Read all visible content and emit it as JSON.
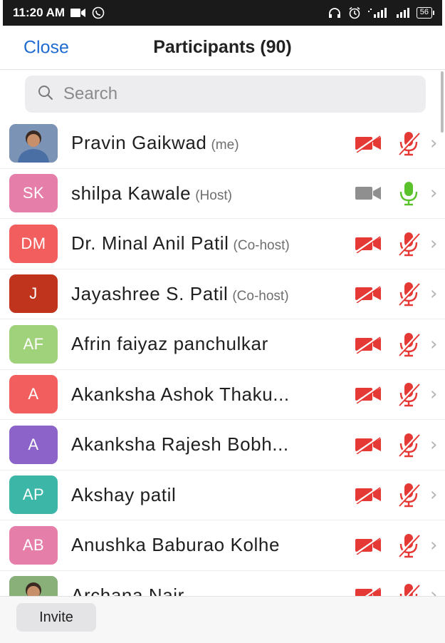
{
  "status_bar": {
    "time": "11:20 AM",
    "battery": "56",
    "left_icons": [
      "video-camera-icon",
      "whatsapp-icon"
    ],
    "right_icons": [
      "headphones-icon",
      "alarm-icon",
      "signal-icon",
      "signal-icon"
    ]
  },
  "header": {
    "close_label": "Close",
    "title": "Participants (90)"
  },
  "search": {
    "placeholder": "Search"
  },
  "colors": {
    "accent": "#1f6bd0",
    "muted_red": "#e53935",
    "unmuted_green": "#5cc22c",
    "video_on_gray": "#8f8f8f"
  },
  "participants": [
    {
      "initials": "",
      "name": "Pravin Gaikwad",
      "role": "(me)",
      "avatar_color": "#7b93b5",
      "video": "off",
      "mic": "muted"
    },
    {
      "initials": "SK",
      "name": "shilpa Kawale",
      "role": "(Host)",
      "avatar_color": "#e57ea9",
      "video": "on",
      "mic": "on"
    },
    {
      "initials": "DM",
      "name": "Dr. Minal Anil Patil",
      "role": "(Co-host)",
      "avatar_color": "#f25d5d",
      "video": "off",
      "mic": "muted"
    },
    {
      "initials": "J",
      "name": "Jayashree S. Patil",
      "role": "(Co-host)",
      "avatar_color": "#c0331c",
      "video": "off",
      "mic": "muted"
    },
    {
      "initials": "AF",
      "name": "Afrin faiyaz panchulkar",
      "role": "",
      "avatar_color": "#9fd27a",
      "video": "off",
      "mic": "muted"
    },
    {
      "initials": "A",
      "name": "Akanksha  Ashok Thaku...",
      "role": "",
      "avatar_color": "#f25d5d",
      "video": "off",
      "mic": "muted"
    },
    {
      "initials": "A",
      "name": "Akanksha  Rajesh  Bobh...",
      "role": "",
      "avatar_color": "#8b63c9",
      "video": "off",
      "mic": "muted"
    },
    {
      "initials": "AP",
      "name": "Akshay patil",
      "role": "",
      "avatar_color": "#3cb7a7",
      "video": "off",
      "mic": "muted"
    },
    {
      "initials": "AB",
      "name": "Anushka Baburao Kolhe",
      "role": "",
      "avatar_color": "#e57ea9",
      "video": "off",
      "mic": "muted"
    },
    {
      "initials": "",
      "name": "Archana Nair",
      "role": "",
      "avatar_color": "#8ab07a",
      "video": "off",
      "mic": "muted"
    }
  ],
  "footer": {
    "invite_label": "Invite"
  }
}
